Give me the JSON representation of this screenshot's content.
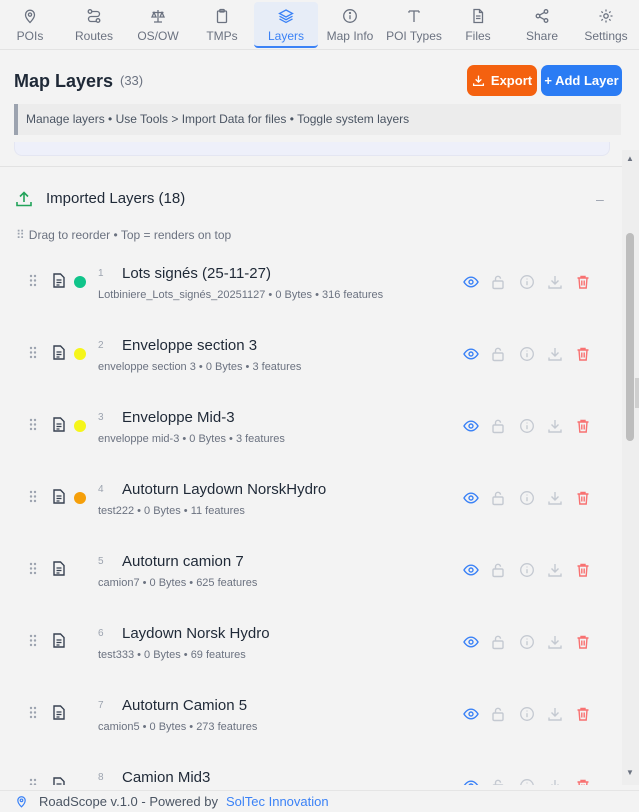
{
  "nav": {
    "tabs": [
      {
        "label": "POIs",
        "icon": "map-pin-icon"
      },
      {
        "label": "Routes",
        "icon": "route-icon"
      },
      {
        "label": "OS/OW",
        "icon": "scale-icon"
      },
      {
        "label": "TMPs",
        "icon": "clipboard-icon"
      },
      {
        "label": "Layers",
        "icon": "layers-icon",
        "active": true
      },
      {
        "label": "Map Info",
        "icon": "info-icon"
      },
      {
        "label": "POI Types",
        "icon": "type-icon"
      },
      {
        "label": "Files",
        "icon": "file-icon"
      },
      {
        "label": "Share",
        "icon": "share-icon"
      },
      {
        "label": "Settings",
        "icon": "gear-icon"
      }
    ]
  },
  "header": {
    "title": "Map Layers",
    "count": "(33)",
    "export_label": "Export",
    "add_label": "+ Add Layer",
    "hint": "Manage layers • Use Tools > Import Data for files • Toggle system layers"
  },
  "section": {
    "title": "Imported Layers (18)",
    "toggle": "–",
    "drag_hint": "Drag to reorder • Top = renders on top"
  },
  "layers": [
    {
      "num": "1",
      "name": "Lots signés (25-11-27)",
      "meta": "Lotbiniere_Lots_signés_20251127 • 0 Bytes • 316 features",
      "color": "#10c48a"
    },
    {
      "num": "2",
      "name": "Enveloppe section 3",
      "meta": "enveloppe section 3 • 0 Bytes • 3 features",
      "color": "#f5f51a"
    },
    {
      "num": "3",
      "name": "Enveloppe Mid-3",
      "meta": "enveloppe mid-3 • 0 Bytes • 3 features",
      "color": "#f5f51a"
    },
    {
      "num": "4",
      "name": "Autoturn Laydown NorskHydro",
      "meta": "test222 • 0 Bytes • 11 features",
      "color": "#f59f0a"
    },
    {
      "num": "5",
      "name": "Autoturn camion 7",
      "meta": "camion7 • 0 Bytes • 625 features",
      "color": ""
    },
    {
      "num": "6",
      "name": "Laydown Norsk Hydro",
      "meta": "test333 • 0 Bytes • 69 features",
      "color": ""
    },
    {
      "num": "7",
      "name": "Autoturn Camion 5",
      "meta": "camion5 • 0 Bytes • 273 features",
      "color": ""
    },
    {
      "num": "8",
      "name": "Camion Mid3",
      "meta": "",
      "color": ""
    }
  ],
  "footer": {
    "app": "RoadScope v.1.0 - Powered by",
    "brand": "SolTec Innovation"
  },
  "colors": {
    "accent": "#3b82f6",
    "export": "#f4610f",
    "add": "#2b7cf4",
    "delete": "#f87171"
  }
}
